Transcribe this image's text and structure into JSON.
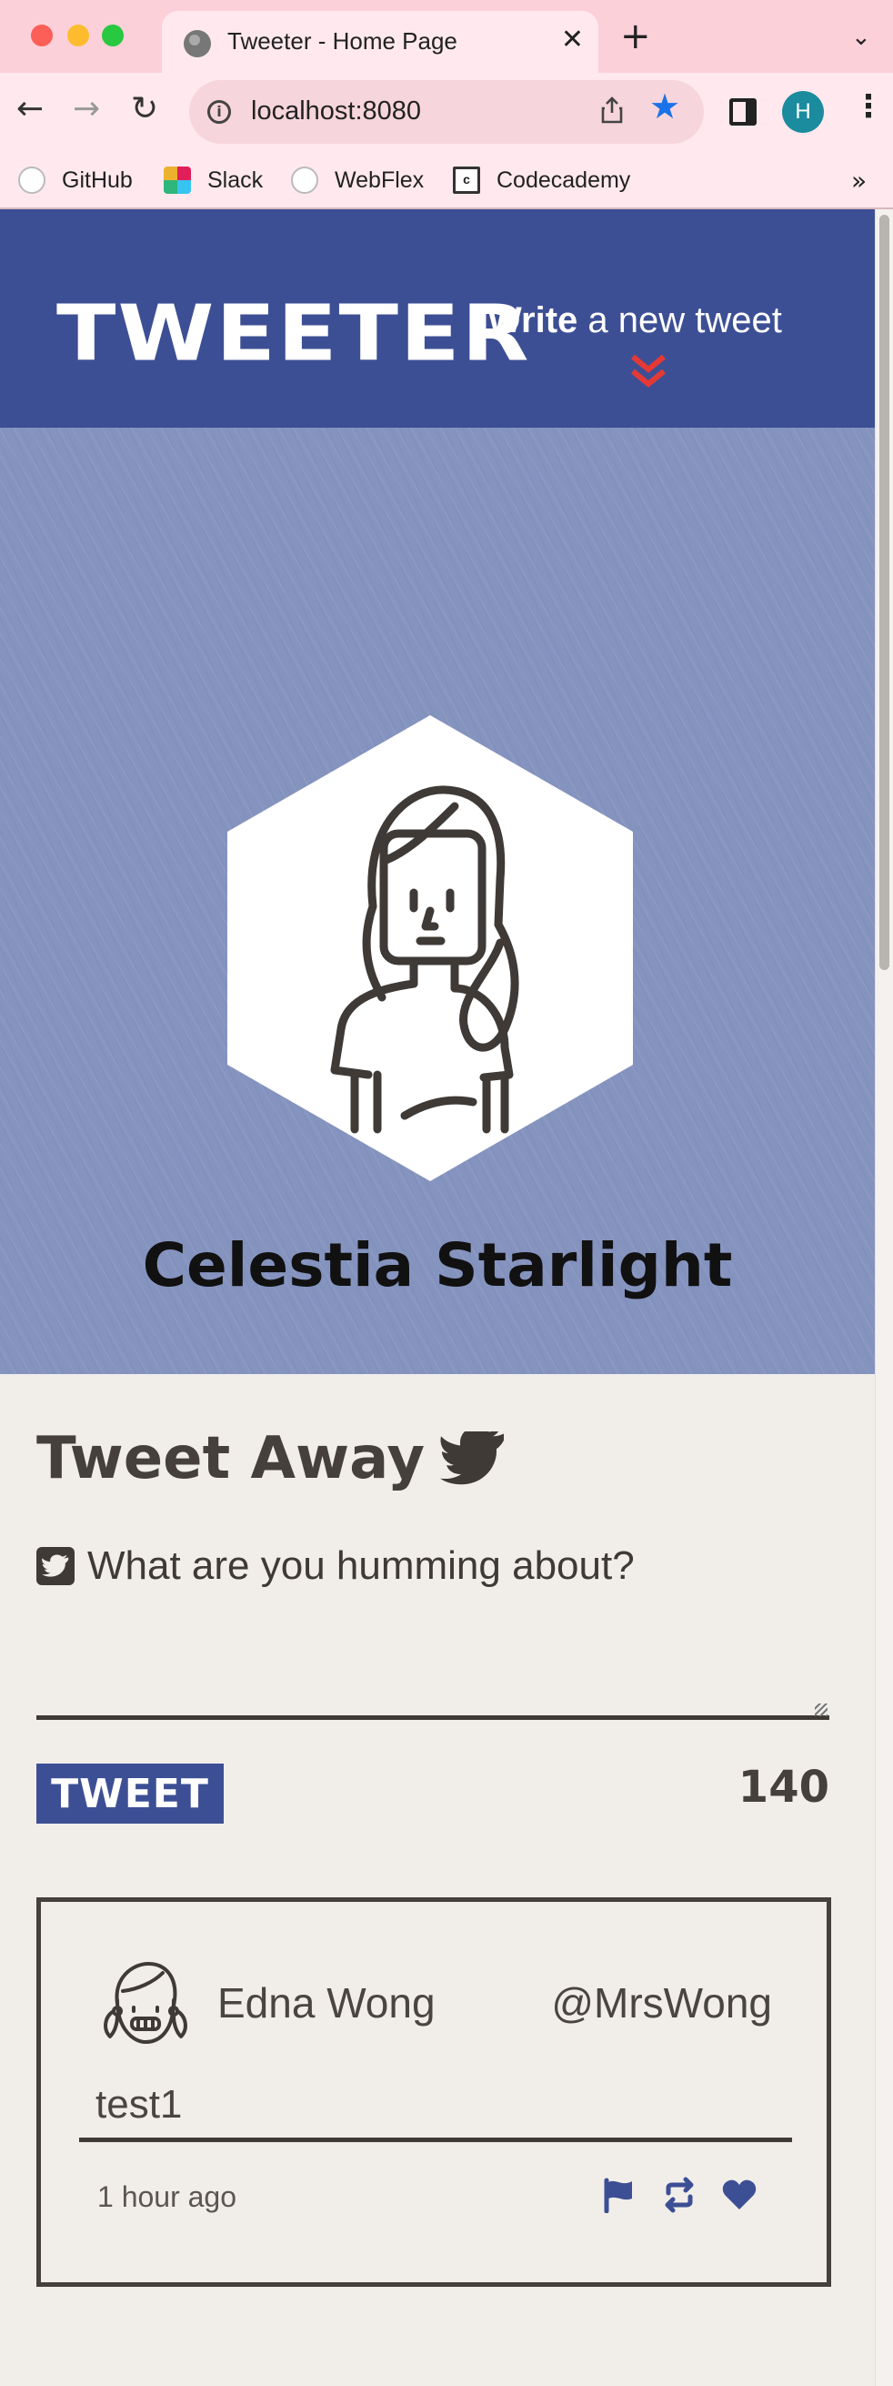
{
  "browser": {
    "tab_title": "Tweeter - Home Page",
    "close_glyph": "✕",
    "new_tab_glyph": "+",
    "tab_menu_glyph": "⌄",
    "url": "localhost:8080",
    "profile_initial": "H",
    "back_glyph": "←",
    "forward_glyph": "→",
    "reload_glyph": "↻",
    "star_glyph": "★",
    "menu_glyph": "⋮",
    "bookmarks": [
      "GitHub",
      "Slack",
      "WebFlex",
      "Codecademy"
    ],
    "bookmarks_more": "»",
    "accent": "#1a73e8"
  },
  "nav": {
    "logo": "TWEETER",
    "write_bold": "Write",
    "write_rest": " a new tweet",
    "nav_color": "#3d4f94",
    "arrow_color": "#e53935"
  },
  "profile": {
    "name": "Celestia Starlight"
  },
  "compose": {
    "title": "Tweet Away",
    "label": "What are you humming about?",
    "textarea_value": "",
    "button_label": "TWEET",
    "counter": "140"
  },
  "tweets": [
    {
      "name": "Edna Wong",
      "handle": "@MrsWong",
      "body": "test1",
      "time": "1 hour ago",
      "icons": [
        "flag-icon",
        "retweet-icon",
        "heart-icon"
      ]
    }
  ]
}
